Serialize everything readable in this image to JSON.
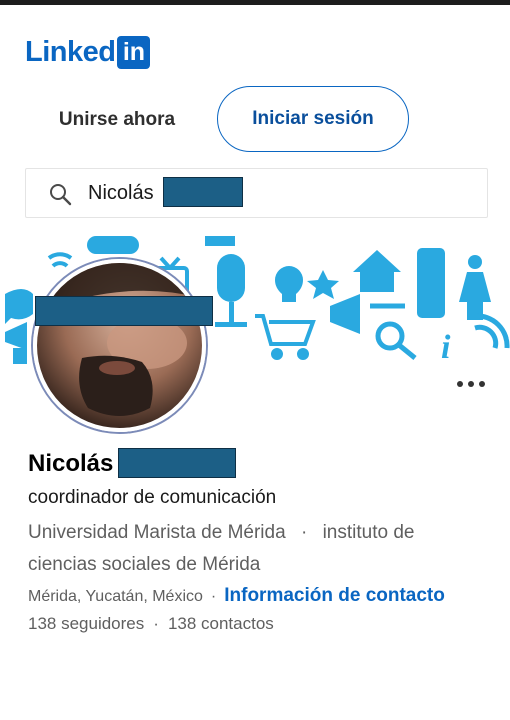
{
  "brand": {
    "word": "Linked",
    "box": "in",
    "color": "#0a66c2"
  },
  "auth": {
    "join_label": "Unirse ahora",
    "signin_label": "Iniciar sesión"
  },
  "search": {
    "query": "Nicolás"
  },
  "profile": {
    "first_name": "Nicolás",
    "headline": "coordinador de comunicación",
    "education_1": "Universidad Marista de Mérida",
    "education_sep": "·",
    "education_2": "instituto de ciencias sociales de Mérida",
    "location": "Mérida, Yucatán, México",
    "location_sep": "·",
    "contact_link": "Información de contacto",
    "followers": "138 seguidores",
    "stats_sep": "·",
    "connections": "138 contactos"
  },
  "banner": {
    "icons": [
      "chat-bubble-icon",
      "sms-icon",
      "wifi-icon",
      "tv-icon",
      "microphone-icon",
      "lightbulb-icon",
      "star-icon",
      "house-icon",
      "mobile-phone-icon",
      "person-icon",
      "tablet-icon",
      "shopping-cart-icon",
      "megaphone-icon",
      "wrench-icon",
      "search-icon",
      "info-icon"
    ],
    "icon_color": "#2aa9e0"
  },
  "colors": {
    "accent": "#0a66c2",
    "redaction": "#1c5f86",
    "muted_text": "#5f5f5f"
  }
}
